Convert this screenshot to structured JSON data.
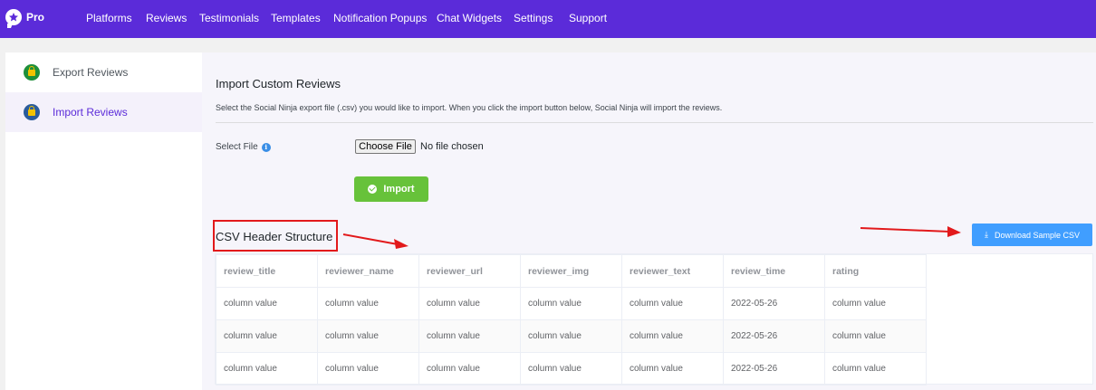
{
  "header": {
    "logo_text": "Pro",
    "nav": [
      "Platforms",
      "Reviews",
      "Testimonials",
      "Templates",
      "Notification Popups",
      "Chat Widgets",
      "Settings",
      "Support"
    ]
  },
  "sidebar": {
    "items": [
      {
        "label": "Export Reviews",
        "icon": "lock-icon",
        "icon_bg": "#1e8f3a"
      },
      {
        "label": "Import Reviews",
        "icon": "lock-icon",
        "icon_bg": "#2a5c9c"
      }
    ]
  },
  "main": {
    "title": "Import Custom Reviews",
    "description": "Select the Social Ninja export file (.csv) you would like to import. When you click the import button below, Social Ninja will import the reviews.",
    "select_file_label": "Select File",
    "info_icon": "i",
    "choose_file_label": "Choose File",
    "no_file_text": "No file chosen",
    "import_label": "Import",
    "csv_heading": "CSV Header Structure",
    "download_label": "Download Sample CSV",
    "download_icon": "⤓"
  },
  "table": {
    "headers": [
      "review_title",
      "reviewer_name",
      "reviewer_url",
      "reviewer_img",
      "reviewer_text",
      "review_time",
      "rating"
    ],
    "rows": [
      [
        "column value",
        "column value",
        "column value",
        "column value",
        "column value",
        "2022-05-26",
        "column value"
      ],
      [
        "column value",
        "column value",
        "column value",
        "column value",
        "column value",
        "2022-05-26",
        "column value"
      ],
      [
        "column value",
        "column value",
        "column value",
        "column value",
        "column value",
        "2022-05-26",
        "column value"
      ]
    ]
  },
  "colors": {
    "brand": "#5b2bd9",
    "import_button": "#67c23a",
    "download_button": "#409eff",
    "annotation": "#e2191b"
  }
}
